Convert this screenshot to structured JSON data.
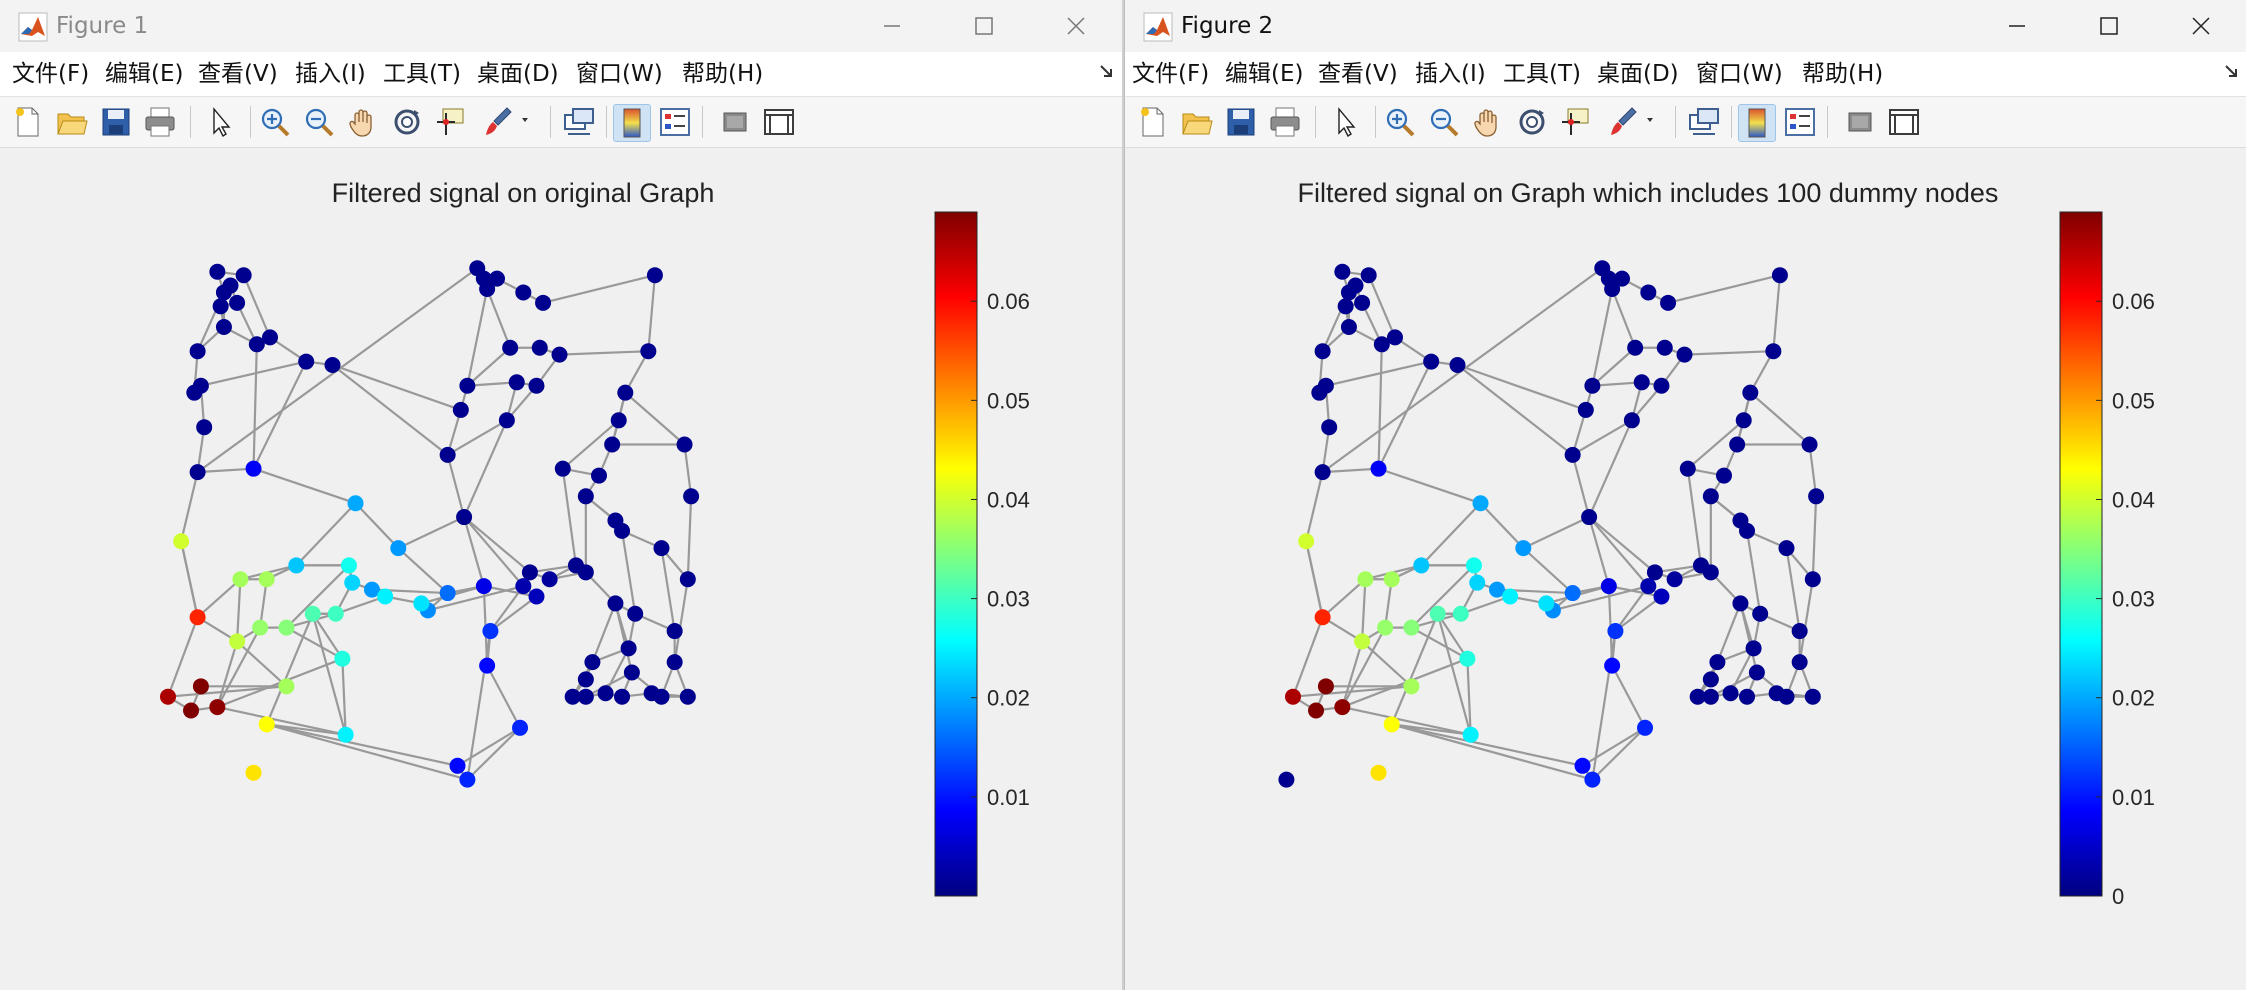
{
  "menus": [
    "文件(F)",
    "编辑(E)",
    "查看(V)",
    "插入(I)",
    "工具(T)",
    "桌面(D)",
    "窗口(W)",
    "帮助(H)"
  ],
  "toolbar_icons": [
    "new-figure-icon",
    "open-file-icon",
    "save-icon",
    "print-icon",
    "select-arrow-icon",
    "zoom-in-icon",
    "zoom-out-icon",
    "pan-hand-icon",
    "rotate-3d-icon",
    "data-cursor-icon",
    "brush-icon",
    "brush-dropdown-icon",
    "link-plot-icon",
    "colorbar-icon",
    "legend-icon",
    "hide-plot-tools-icon",
    "show-plot-tools-icon"
  ],
  "colors": {
    "edge": "#999999",
    "jet_low": "#00008f",
    "jet_high": "#800000"
  },
  "figure1": {
    "window_title": "Figure 1",
    "chart_data": {
      "type": "scatter",
      "subtype": "graph-signal",
      "title": "Filtered signal on original Graph",
      "colormap": "jet",
      "clim": [
        0,
        0.069
      ],
      "colorbar_ticks": [
        "0.01",
        "0.02",
        "0.03",
        "0.04",
        "0.05",
        "0.06"
      ],
      "colorbar_tick_values": [
        0.01,
        0.02,
        0.03,
        0.04,
        0.05,
        0.06
      ],
      "nodes": [
        [
          0.9,
          16.0,
          0.001
        ],
        [
          1.7,
          17.7,
          0.001
        ],
        [
          1.5,
          18.3,
          0.001
        ],
        [
          2.3,
          18.2,
          0.001
        ],
        [
          1.9,
          17.9,
          0.001
        ],
        [
          2.1,
          17.4,
          0.001
        ],
        [
          1.6,
          17.3,
          0.001
        ],
        [
          1.7,
          16.7,
          0.001
        ],
        [
          0.8,
          14.8,
          0.001
        ],
        [
          1.0,
          15.0,
          0.001
        ],
        [
          1.1,
          13.8,
          0.001
        ],
        [
          0.9,
          12.5,
          0.001
        ],
        [
          2.7,
          16.2,
          0.001
        ],
        [
          3.1,
          16.4,
          0.001
        ],
        [
          4.2,
          15.7,
          0.001
        ],
        [
          5.0,
          15.6,
          0.001
        ],
        [
          9.7,
          17.8,
          0.001
        ],
        [
          9.4,
          18.4,
          0.001
        ],
        [
          9.6,
          18.1,
          0.001
        ],
        [
          10.0,
          18.1,
          0.001
        ],
        [
          10.8,
          17.7,
          0.001
        ],
        [
          11.4,
          17.4,
          0.001
        ],
        [
          14.8,
          18.2,
          0.001
        ],
        [
          14.6,
          16.0,
          0.001
        ],
        [
          10.4,
          16.1,
          0.001
        ],
        [
          11.3,
          16.1,
          0.001
        ],
        [
          11.9,
          15.9,
          0.001
        ],
        [
          9.1,
          15.0,
          0.001
        ],
        [
          10.6,
          15.1,
          0.001
        ],
        [
          11.2,
          15.0,
          0.001
        ],
        [
          13.9,
          14.8,
          0.001
        ],
        [
          8.9,
          14.3,
          0.001
        ],
        [
          13.7,
          14.0,
          0.001
        ],
        [
          10.3,
          14.0,
          0.001
        ],
        [
          8.5,
          13.0,
          0.001
        ],
        [
          13.5,
          13.3,
          0.001
        ],
        [
          15.7,
          13.3,
          0.001
        ],
        [
          12.0,
          12.6,
          0.001
        ],
        [
          13.1,
          12.4,
          0.001
        ],
        [
          12.7,
          11.8,
          0.001
        ],
        [
          15.9,
          11.8,
          0.001
        ],
        [
          9.0,
          11.2,
          0.001
        ],
        [
          13.6,
          11.1,
          0.001
        ],
        [
          13.8,
          10.8,
          0.001
        ],
        [
          15.0,
          10.3,
          0.001
        ],
        [
          12.4,
          9.8,
          0.001
        ],
        [
          12.7,
          9.6,
          0.001
        ],
        [
          15.8,
          9.4,
          0.001
        ],
        [
          11.0,
          9.6,
          0.001
        ],
        [
          10.8,
          9.2,
          0.003
        ],
        [
          11.6,
          9.4,
          0.002
        ],
        [
          11.2,
          8.9,
          0.004
        ],
        [
          9.6,
          9.2,
          0.007
        ],
        [
          13.6,
          8.7,
          0.001
        ],
        [
          14.2,
          8.4,
          0.001
        ],
        [
          15.4,
          7.9,
          0.001
        ],
        [
          14.0,
          7.4,
          0.001
        ],
        [
          12.9,
          7.0,
          0.001
        ],
        [
          15.4,
          7.0,
          0.001
        ],
        [
          12.7,
          6.5,
          0.001
        ],
        [
          12.3,
          6.0,
          0.001
        ],
        [
          12.7,
          6.0,
          0.001
        ],
        [
          13.3,
          6.1,
          0.001
        ],
        [
          13.8,
          6.0,
          0.001
        ],
        [
          14.7,
          6.1,
          0.001
        ],
        [
          15.8,
          6.0,
          0.001
        ],
        [
          14.1,
          6.7,
          0.001
        ],
        [
          15.0,
          6.0,
          0.001
        ],
        [
          9.7,
          6.9,
          0.009
        ],
        [
          9.8,
          7.9,
          0.012
        ],
        [
          10.7,
          5.1,
          0.011
        ],
        [
          8.8,
          4.0,
          0.009
        ],
        [
          9.1,
          3.6,
          0.011
        ],
        [
          5.7,
          11.6,
          0.02
        ],
        [
          7.0,
          10.3,
          0.019
        ],
        [
          2.6,
          12.6,
          0.008
        ],
        [
          3.9,
          9.8,
          0.022
        ],
        [
          5.6,
          9.3,
          0.023
        ],
        [
          6.2,
          9.1,
          0.019
        ],
        [
          6.6,
          8.9,
          0.025
        ],
        [
          5.1,
          8.4,
          0.03
        ],
        [
          5.5,
          9.8,
          0.027
        ],
        [
          8.5,
          9.0,
          0.016
        ],
        [
          7.9,
          8.5,
          0.018
        ],
        [
          7.7,
          8.7,
          0.024
        ],
        [
          0.4,
          10.5,
          0.04
        ],
        [
          2.2,
          9.4,
          0.037
        ],
        [
          3.0,
          9.4,
          0.037
        ],
        [
          0.9,
          8.3,
          0.058
        ],
        [
          2.1,
          7.6,
          0.039
        ],
        [
          2.8,
          8.0,
          0.036
        ],
        [
          3.6,
          8.0,
          0.035
        ],
        [
          4.4,
          8.4,
          0.031
        ],
        [
          5.3,
          7.1,
          0.028
        ],
        [
          3.6,
          6.3,
          0.037
        ],
        [
          0.0,
          6.0,
          0.066
        ],
        [
          1.0,
          6.3,
          0.069
        ],
        [
          0.7,
          5.6,
          0.069
        ],
        [
          1.5,
          5.7,
          0.068
        ],
        [
          3.0,
          5.2,
          0.043
        ],
        [
          5.4,
          4.9,
          0.025
        ],
        [
          2.6,
          3.8,
          0.045
        ]
      ],
      "edges": [
        [
          0,
          1
        ],
        [
          1,
          2
        ],
        [
          2,
          3
        ],
        [
          1,
          4
        ],
        [
          4,
          5
        ],
        [
          5,
          6
        ],
        [
          6,
          7
        ],
        [
          7,
          12
        ],
        [
          12,
          13
        ],
        [
          13,
          14
        ],
        [
          14,
          15
        ],
        [
          0,
          8
        ],
        [
          8,
          9
        ],
        [
          9,
          10
        ],
        [
          10,
          11
        ],
        [
          0,
          7
        ],
        [
          1,
          7
        ],
        [
          3,
          13
        ],
        [
          5,
          12
        ],
        [
          9,
          14
        ],
        [
          11,
          17
        ],
        [
          16,
          17
        ],
        [
          17,
          18
        ],
        [
          18,
          19
        ],
        [
          19,
          20
        ],
        [
          20,
          21
        ],
        [
          21,
          22
        ],
        [
          22,
          23
        ],
        [
          16,
          24
        ],
        [
          24,
          25
        ],
        [
          25,
          26
        ],
        [
          26,
          23
        ],
        [
          16,
          27
        ],
        [
          27,
          28
        ],
        [
          28,
          29
        ],
        [
          29,
          26
        ],
        [
          27,
          31
        ],
        [
          31,
          34
        ],
        [
          34,
          33
        ],
        [
          33,
          28
        ],
        [
          15,
          31
        ],
        [
          15,
          34
        ],
        [
          23,
          30
        ],
        [
          30,
          32
        ],
        [
          32,
          35
        ],
        [
          35,
          36
        ],
        [
          36,
          40
        ],
        [
          40,
          47
        ],
        [
          32,
          37
        ],
        [
          37,
          38
        ],
        [
          38,
          39
        ],
        [
          39,
          42
        ],
        [
          42,
          43
        ],
        [
          43,
          44
        ],
        [
          44,
          47
        ],
        [
          35,
          38
        ],
        [
          37,
          45
        ],
        [
          45,
          46
        ],
        [
          46,
          39
        ],
        [
          34,
          41
        ],
        [
          41,
          33
        ],
        [
          41,
          48
        ],
        [
          41,
          49
        ],
        [
          41,
          52
        ],
        [
          48,
          50
        ],
        [
          49,
          51
        ],
        [
          50,
          46
        ],
        [
          45,
          48
        ],
        [
          52,
          51
        ],
        [
          53,
          54
        ],
        [
          54,
          55
        ],
        [
          55,
          58
        ],
        [
          53,
          56
        ],
        [
          56,
          57
        ],
        [
          57,
          59
        ],
        [
          59,
          60
        ],
        [
          60,
          61
        ],
        [
          61,
          62
        ],
        [
          62,
          63
        ],
        [
          63,
          64
        ],
        [
          64,
          65
        ],
        [
          53,
          66
        ],
        [
          66,
          67
        ],
        [
          67,
          65
        ],
        [
          66,
          63
        ],
        [
          56,
          62
        ],
        [
          58,
          67
        ],
        [
          57,
          60
        ],
        [
          58,
          65
        ],
        [
          46,
          53
        ],
        [
          43,
          54
        ],
        [
          44,
          55
        ],
        [
          47,
          58
        ],
        [
          52,
          68
        ],
        [
          68,
          69
        ],
        [
          69,
          51
        ],
        [
          68,
          70
        ],
        [
          70,
          71
        ],
        [
          71,
          72
        ],
        [
          72,
          70
        ],
        [
          69,
          49
        ],
        [
          73,
          74
        ],
        [
          74,
          41
        ],
        [
          73,
          75
        ],
        [
          75,
          11
        ],
        [
          12,
          75
        ],
        [
          74,
          82
        ],
        [
          82,
          83
        ],
        [
          83,
          84
        ],
        [
          84,
          79
        ],
        [
          79,
          78
        ],
        [
          78,
          77
        ],
        [
          77,
          81
        ],
        [
          81,
          76
        ],
        [
          76,
          73
        ],
        [
          76,
          87
        ],
        [
          86,
          87
        ],
        [
          86,
          88
        ],
        [
          88,
          85
        ],
        [
          85,
          11
        ],
        [
          88,
          89
        ],
        [
          89,
          90
        ],
        [
          90,
          91
        ],
        [
          91,
          80
        ],
        [
          80,
          79
        ],
        [
          89,
          94
        ],
        [
          94,
          95
        ],
        [
          94,
          96
        ],
        [
          95,
          97
        ],
        [
          96,
          97
        ],
        [
          97,
          98
        ],
        [
          98,
          93
        ],
        [
          93,
          92
        ],
        [
          92,
          80
        ],
        [
          92,
          99
        ],
        [
          99,
          71
        ],
        [
          93,
          100
        ],
        [
          100,
          99
        ],
        [
          98,
          100
        ],
        [
          86,
          89
        ],
        [
          87,
          90
        ],
        [
          81,
          91
        ],
        [
          85,
          88
        ],
        [
          82,
          52
        ],
        [
          84,
          52
        ],
        [
          80,
          92
        ],
        [
          88,
          95
        ],
        [
          90,
          98
        ],
        [
          91,
          93
        ],
        [
          99,
          72
        ],
        [
          80,
          77
        ],
        [
          86,
          76
        ],
        [
          87,
          76
        ],
        [
          89,
          98
        ],
        [
          92,
          100
        ],
        [
          53,
          57
        ],
        [
          61,
          66
        ],
        [
          54,
          56
        ],
        [
          30,
          35
        ],
        [
          36,
          30
        ],
        [
          42,
          39
        ],
        [
          45,
          50
        ],
        [
          29,
          33
        ],
        [
          27,
          24
        ],
        [
          14,
          75
        ],
        [
          76,
          81
        ],
        [
          81,
          77
        ],
        [
          82,
          78
        ],
        [
          83,
          49
        ],
        [
          69,
          72
        ]
      ]
    }
  },
  "figure2": {
    "window_title": "Figure 2",
    "chart_data": {
      "type": "scatter",
      "subtype": "graph-signal",
      "title": "Filtered signal on Graph which includes 100 dummy nodes",
      "colormap": "jet",
      "clim": [
        0,
        0.069
      ],
      "colorbar_ticks": [
        "0",
        "0.01",
        "0.02",
        "0.03",
        "0.04",
        "0.05",
        "0.06"
      ],
      "colorbar_tick_values": [
        0,
        0.01,
        0.02,
        0.03,
        0.04,
        0.05,
        0.06
      ],
      "same_graph_as": "figure1",
      "extra_nodes": [
        [
          -0.2,
          3.6,
          0.001
        ]
      ]
    }
  }
}
